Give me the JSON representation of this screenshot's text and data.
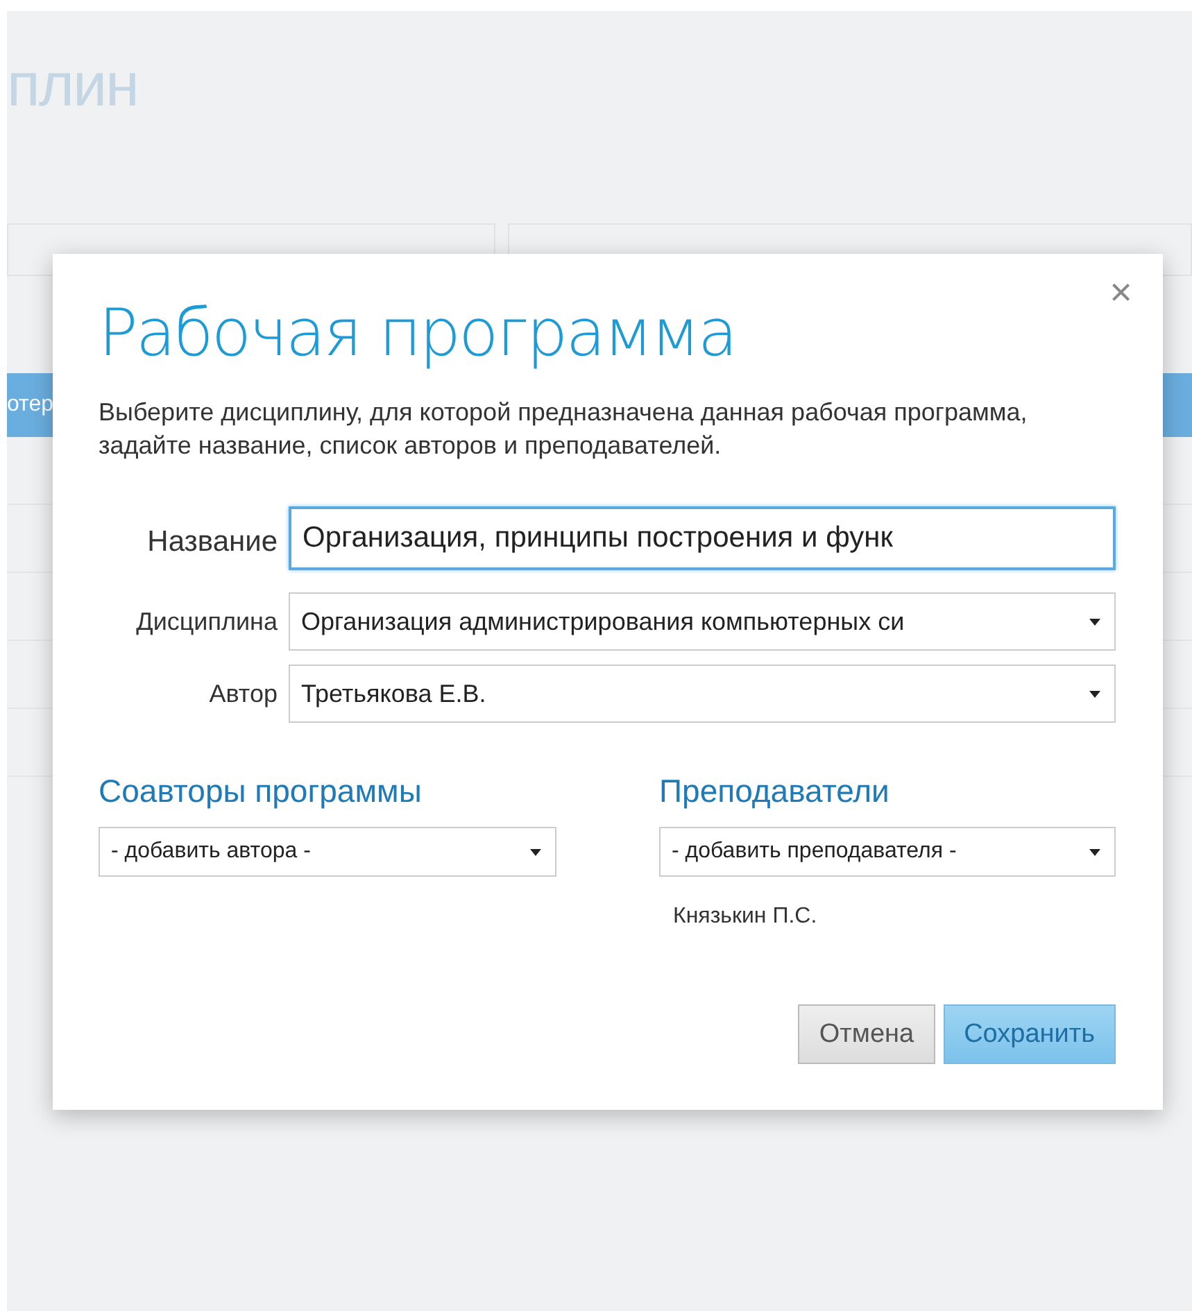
{
  "background_page": {
    "title": "плин",
    "table_header": "отер"
  },
  "dialog": {
    "title": "Рабочая программа",
    "close": "×",
    "description": "Выберите дисциплину, для которой предназначена данная рабочая программа, задайте название, список авторов и преподавателей.",
    "fields": [
      {
        "kind": "input",
        "label": "Название",
        "value": "Организация, принципы построения и функ",
        "focused": true
      },
      {
        "kind": "select",
        "label": "Дисциплина",
        "value": "Организация администрирования компьютерных си",
        "focused": false
      },
      {
        "kind": "select",
        "label": "Автор",
        "value": "Третьякова Е.В.",
        "focused": false
      }
    ],
    "columns": [
      {
        "heading": "Соавторы программы",
        "select": "- добавить автора -"
      },
      {
        "heading": "Преподаватели",
        "select": "- добавить преподавателя -",
        "items": [
          "Князькин П.С."
        ]
      }
    ],
    "buttons": [
      {
        "label": "Отмена",
        "kind": "secondary"
      },
      {
        "label": "Сохранить",
        "kind": "primary"
      }
    ]
  }
}
